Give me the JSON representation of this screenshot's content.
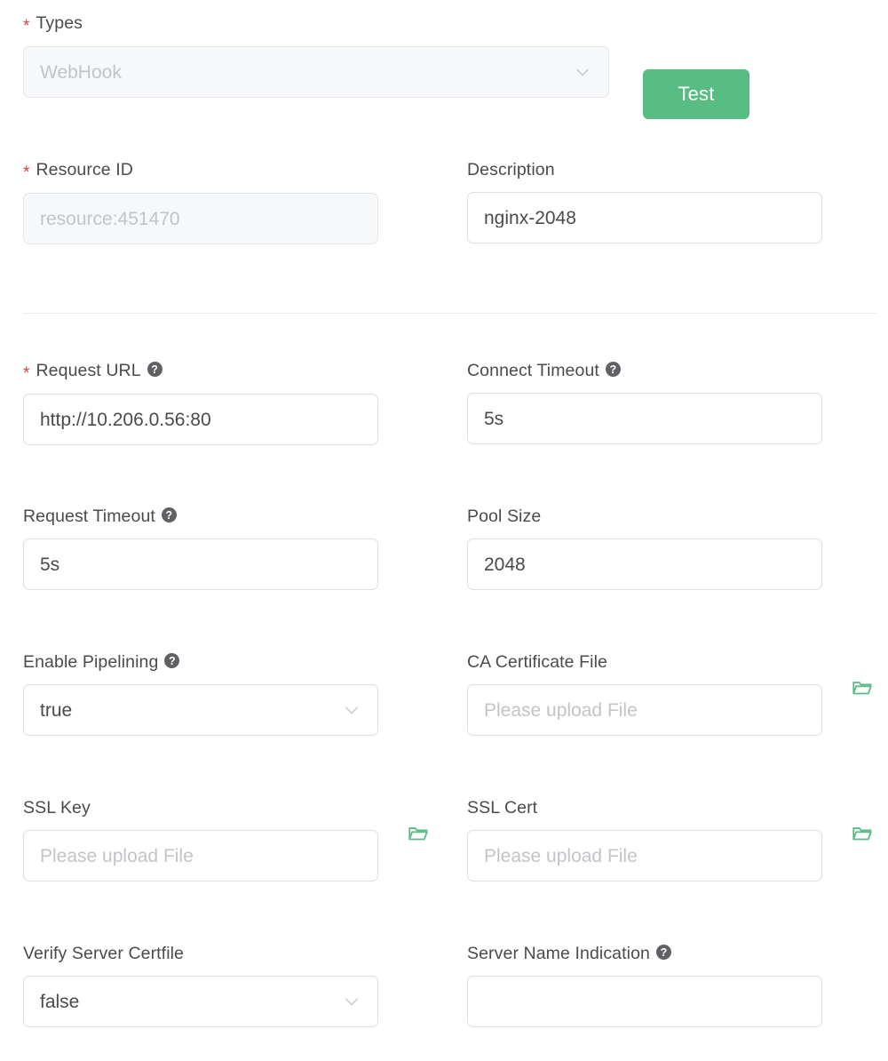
{
  "colors": {
    "accent_green": "#58bd83",
    "required_red": "#d9443f",
    "label_gray": "#4b4b4b",
    "placeholder_gray": "#c2c4c8",
    "border_gray": "#dcdfe3",
    "disabled_bg": "#f7f8f9",
    "help_icon_bg": "#5f6164"
  },
  "icons": {
    "help": "help-question-icon",
    "chevron_down": "chevron-down-icon",
    "folder_upload": "folder-open-icon"
  },
  "actions": {
    "test_label": "Test"
  },
  "fields": {
    "types": {
      "label": "Types",
      "required": true,
      "value": "WebHook",
      "disabled": true,
      "control": "select"
    },
    "resource_id": {
      "label": "Resource ID",
      "required": true,
      "placeholder": "resource:451470",
      "disabled": true,
      "control": "text"
    },
    "description": {
      "label": "Description",
      "required": false,
      "value": "nginx-2048",
      "control": "text"
    },
    "request_url": {
      "label": "Request URL",
      "required": true,
      "has_help": true,
      "value": "http://10.206.0.56:80",
      "control": "text"
    },
    "connect_timeout": {
      "label": "Connect Timeout",
      "required": false,
      "has_help": true,
      "value": "5s",
      "control": "text"
    },
    "request_timeout": {
      "label": "Request Timeout",
      "required": false,
      "has_help": true,
      "value": "5s",
      "control": "text"
    },
    "pool_size": {
      "label": "Pool Size",
      "required": false,
      "has_help": false,
      "value": "2048",
      "control": "text"
    },
    "enable_pipelining": {
      "label": "Enable Pipelining",
      "required": false,
      "has_help": true,
      "value": "true",
      "control": "select"
    },
    "ca_certificate_file": {
      "label": "CA Certificate File",
      "required": false,
      "has_help": false,
      "placeholder": "Please upload File",
      "control": "upload"
    },
    "ssl_key": {
      "label": "SSL Key",
      "required": false,
      "has_help": false,
      "placeholder": "Please upload File",
      "control": "upload"
    },
    "ssl_cert": {
      "label": "SSL Cert",
      "required": false,
      "has_help": false,
      "placeholder": "Please upload File",
      "control": "upload"
    },
    "verify_server_certfile": {
      "label": "Verify Server Certfile",
      "required": false,
      "has_help": false,
      "value": "false",
      "control": "select"
    },
    "server_name_indication": {
      "label": "Server Name Indication",
      "required": false,
      "has_help": true,
      "value": "",
      "control": "text"
    }
  }
}
